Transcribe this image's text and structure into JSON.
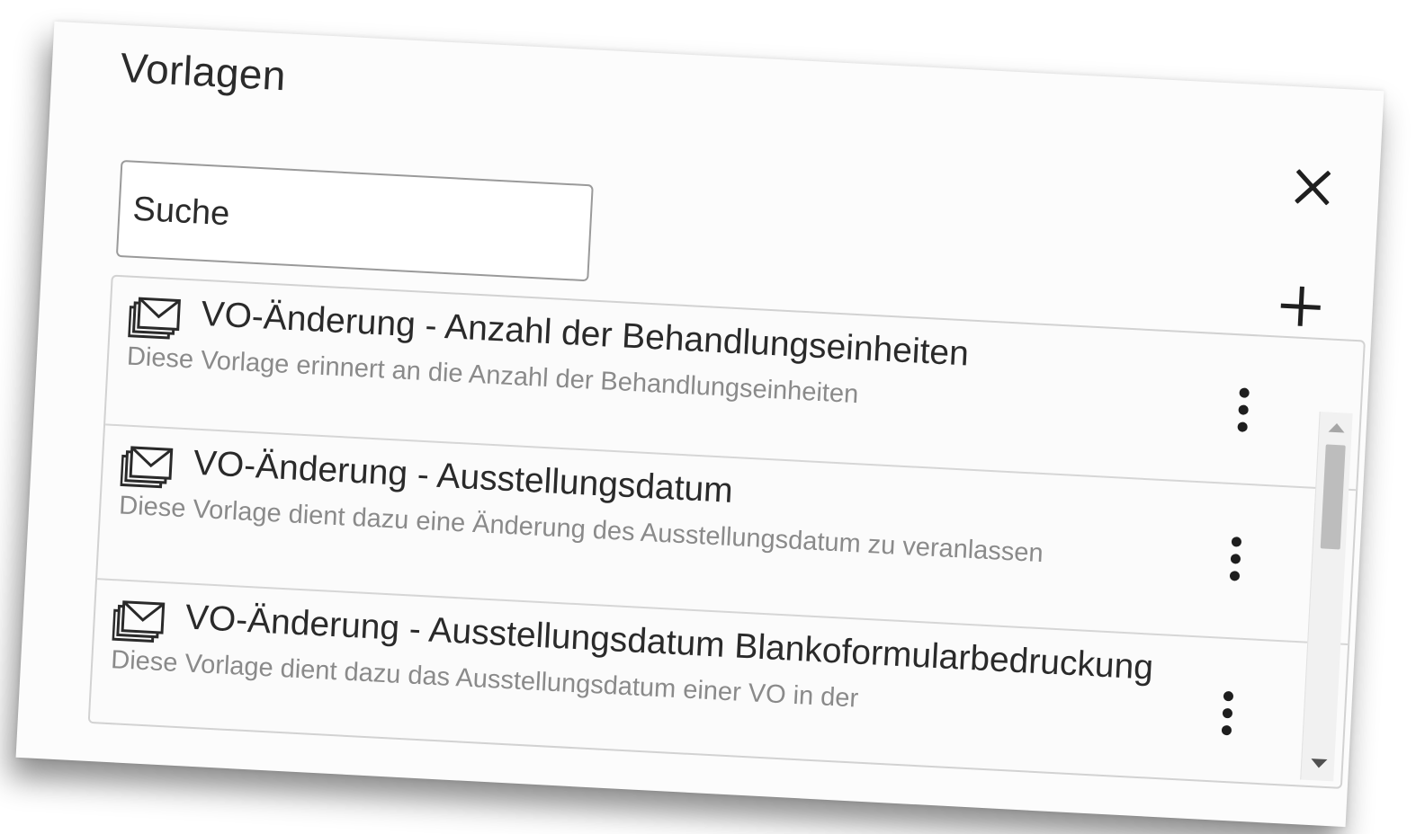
{
  "dialog": {
    "title": "Vorlagen",
    "close_icon": "close-icon",
    "add_icon": "plus-icon"
  },
  "search": {
    "placeholder": "Suche",
    "value": ""
  },
  "templates": [
    {
      "icon": "mail-stack-icon",
      "title": "VO-Änderung - Anzahl der Behandlungseinheiten",
      "description": "Diese Vorlage erinnert an die Anzahl der Behandlungseinheiten",
      "menu_icon": "more-vertical-icon"
    },
    {
      "icon": "mail-stack-icon",
      "title": "VO-Änderung - Ausstellungsdatum",
      "description": "Diese Vorlage dient dazu eine Änderung des Ausstellungsdatum zu veranlassen",
      "menu_icon": "more-vertical-icon"
    },
    {
      "icon": "mail-stack-icon",
      "title": "VO-Änderung - Ausstellungsdatum Blankoformularbedruckung",
      "description": "Diese Vorlage dient dazu das Ausstellungsdatum einer VO in der",
      "menu_icon": "more-vertical-icon"
    }
  ],
  "colors": {
    "background": "#fcfcfc",
    "text": "#2a2a2a",
    "muted_text": "#8a8a8a",
    "border": "#d2d2d2"
  }
}
